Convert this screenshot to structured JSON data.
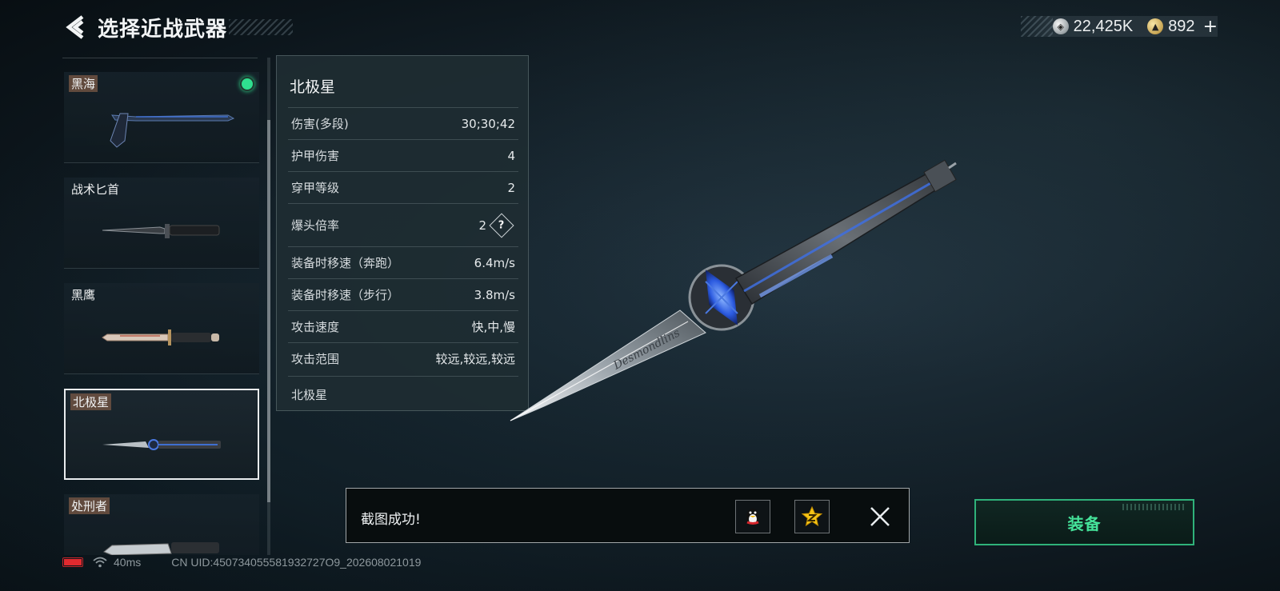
{
  "header": {
    "title": "选择近战武器",
    "back_icon": "chevron-left-icon"
  },
  "currency": {
    "silver_value": "22,425K",
    "gold_value": "892",
    "plus_label": "+"
  },
  "weapon_list": [
    {
      "name": "黑海",
      "tagged": true,
      "equipped": true,
      "selected": false
    },
    {
      "name": "战术匕首",
      "tagged": false,
      "equipped": false,
      "selected": false
    },
    {
      "name": "黑鹰",
      "tagged": false,
      "equipped": false,
      "selected": false
    },
    {
      "name": "北极星",
      "tagged": true,
      "equipped": false,
      "selected": true
    },
    {
      "name": "处刑者",
      "tagged": true,
      "equipped": false,
      "selected": false
    }
  ],
  "stats": {
    "title": "北极星",
    "rows": [
      {
        "label": "伤害(多段)",
        "value": "30;30;42"
      },
      {
        "label": "护甲伤害",
        "value": "4"
      },
      {
        "label": "穿甲等级",
        "value": "2"
      },
      {
        "label": "爆头倍率",
        "value": "2",
        "help": "?"
      },
      {
        "label": "装备时移速（奔跑）",
        "value": "6.4m/s"
      },
      {
        "label": "装备时移速（步行）",
        "value": "3.8m/s"
      },
      {
        "label": "攻击速度",
        "value": "快,中,慢"
      },
      {
        "label": "攻击范围",
        "value": "较远,较远,较远"
      }
    ],
    "footer": "北极星"
  },
  "toast": {
    "message": "截图成功!",
    "share_qq_icon": "qq-penguin-icon",
    "share_qzone_icon": "qzone-star-icon",
    "close_icon": "close-icon"
  },
  "equip_button": {
    "label": "装备"
  },
  "status_bar": {
    "ping": "40ms",
    "uid": "CN UID:450734055581932727O9_202608021019"
  },
  "colors": {
    "accent_green": "#45e39a",
    "equipped_dot": "#2fe08f",
    "battery_red": "#e02a2f",
    "tag_brown": "#6e5242"
  }
}
